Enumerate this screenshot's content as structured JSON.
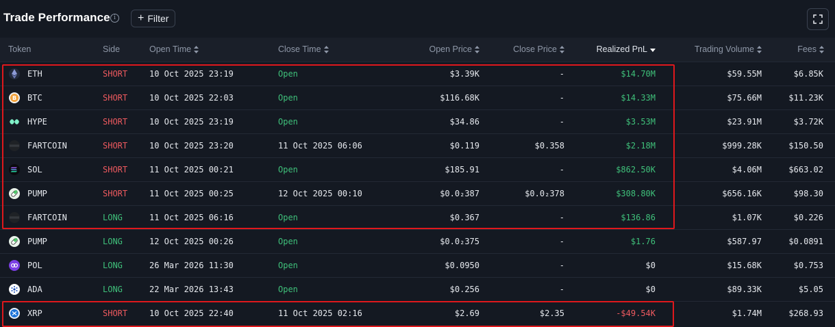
{
  "header": {
    "title": "Trade Performance",
    "info_icon": "info-circle-icon",
    "filter_label": "Filter",
    "expand_icon": "expand-icon"
  },
  "columns": {
    "token": "Token",
    "side": "Side",
    "open_time": "Open Time",
    "close_time": "Close Time",
    "open_price": "Open Price",
    "close_price": "Close Price",
    "realized_pnl": "Realized PnL",
    "trading_volume": "Trading Volume",
    "fees": "Fees"
  },
  "rows": [
    {
      "token": "ETH",
      "icon": "eth-icon",
      "side": "SHORT",
      "side_type": "short",
      "open_time": "10 Oct 2025 23:19",
      "close_time": "Open",
      "open_price": "$3.39K",
      "close_price": "-",
      "pnl": "$14.70M",
      "pnl_type": "pos",
      "volume": "$59.55M",
      "fees": "$6.85K"
    },
    {
      "token": "BTC",
      "icon": "btc-icon",
      "side": "SHORT",
      "side_type": "short",
      "open_time": "10 Oct 2025 22:03",
      "close_time": "Open",
      "open_price": "$116.68K",
      "close_price": "-",
      "pnl": "$14.33M",
      "pnl_type": "pos",
      "volume": "$75.66M",
      "fees": "$11.23K"
    },
    {
      "token": "HYPE",
      "icon": "hype-icon",
      "side": "SHORT",
      "side_type": "short",
      "open_time": "10 Oct 2025 23:19",
      "close_time": "Open",
      "open_price": "$34.86",
      "close_price": "-",
      "pnl": "$3.53M",
      "pnl_type": "pos",
      "volume": "$23.91M",
      "fees": "$3.72K"
    },
    {
      "token": "FARTCOIN",
      "icon": "fartcoin-icon",
      "side": "SHORT",
      "side_type": "short",
      "open_time": "10 Oct 2025 23:20",
      "close_time": "11 Oct 2025 06:06",
      "open_price": "$0.119",
      "close_price": "$0.358",
      "pnl": "$2.18M",
      "pnl_type": "pos",
      "volume": "$999.28K",
      "fees": "$150.50"
    },
    {
      "token": "SOL",
      "icon": "sol-icon",
      "side": "SHORT",
      "side_type": "short",
      "open_time": "11 Oct 2025 00:21",
      "close_time": "Open",
      "open_price": "$185.91",
      "close_price": "-",
      "pnl": "$862.50K",
      "pnl_type": "pos",
      "volume": "$4.06M",
      "fees": "$663.02"
    },
    {
      "token": "PUMP",
      "icon": "pump-icon",
      "side": "SHORT",
      "side_type": "short",
      "open_time": "11 Oct 2025 00:25",
      "close_time": "12 Oct 2025 00:10",
      "open_price": "$0.0₂387",
      "close_price": "$0.0₂378",
      "pnl": "$308.80K",
      "pnl_type": "pos",
      "volume": "$656.16K",
      "fees": "$98.30"
    },
    {
      "token": "FARTCOIN",
      "icon": "fartcoin-icon",
      "side": "LONG",
      "side_type": "long",
      "open_time": "11 Oct 2025 06:16",
      "close_time": "Open",
      "open_price": "$0.367",
      "close_price": "-",
      "pnl": "$136.86",
      "pnl_type": "pos",
      "volume": "$1.07K",
      "fees": "$0.226"
    },
    {
      "token": "PUMP",
      "icon": "pump-icon",
      "side": "LONG",
      "side_type": "long",
      "open_time": "12 Oct 2025 00:26",
      "close_time": "Open",
      "open_price": "$0.0₂375",
      "close_price": "-",
      "pnl": "$1.76",
      "pnl_type": "pos",
      "volume": "$587.97",
      "fees": "$0.0891"
    },
    {
      "token": "POL",
      "icon": "pol-icon",
      "side": "LONG",
      "side_type": "long",
      "open_time": "26 Mar 2026 11:30",
      "close_time": "Open",
      "open_price": "$0.0950",
      "close_price": "-",
      "pnl": "$0",
      "pnl_type": "zero",
      "volume": "$15.68K",
      "fees": "$0.753"
    },
    {
      "token": "ADA",
      "icon": "ada-icon",
      "side": "LONG",
      "side_type": "long",
      "open_time": "22 Mar 2026 13:43",
      "close_time": "Open",
      "open_price": "$0.256",
      "close_price": "-",
      "pnl": "$0",
      "pnl_type": "zero",
      "volume": "$89.33K",
      "fees": "$5.05"
    },
    {
      "token": "XRP",
      "icon": "xrp-icon",
      "side": "SHORT",
      "side_type": "short",
      "open_time": "10 Oct 2025 22:40",
      "close_time": "11 Oct 2025 02:16",
      "open_price": "$2.69",
      "close_price": "$2.35",
      "pnl": "-$49.54K",
      "pnl_type": "neg",
      "volume": "$1.74M",
      "fees": "$268.93"
    }
  ],
  "colors": {
    "background": "#141922",
    "header_row": "#1a1f29",
    "short": "#ef5a5f",
    "long": "#3fc07a",
    "highlight": "#e0181c"
  }
}
